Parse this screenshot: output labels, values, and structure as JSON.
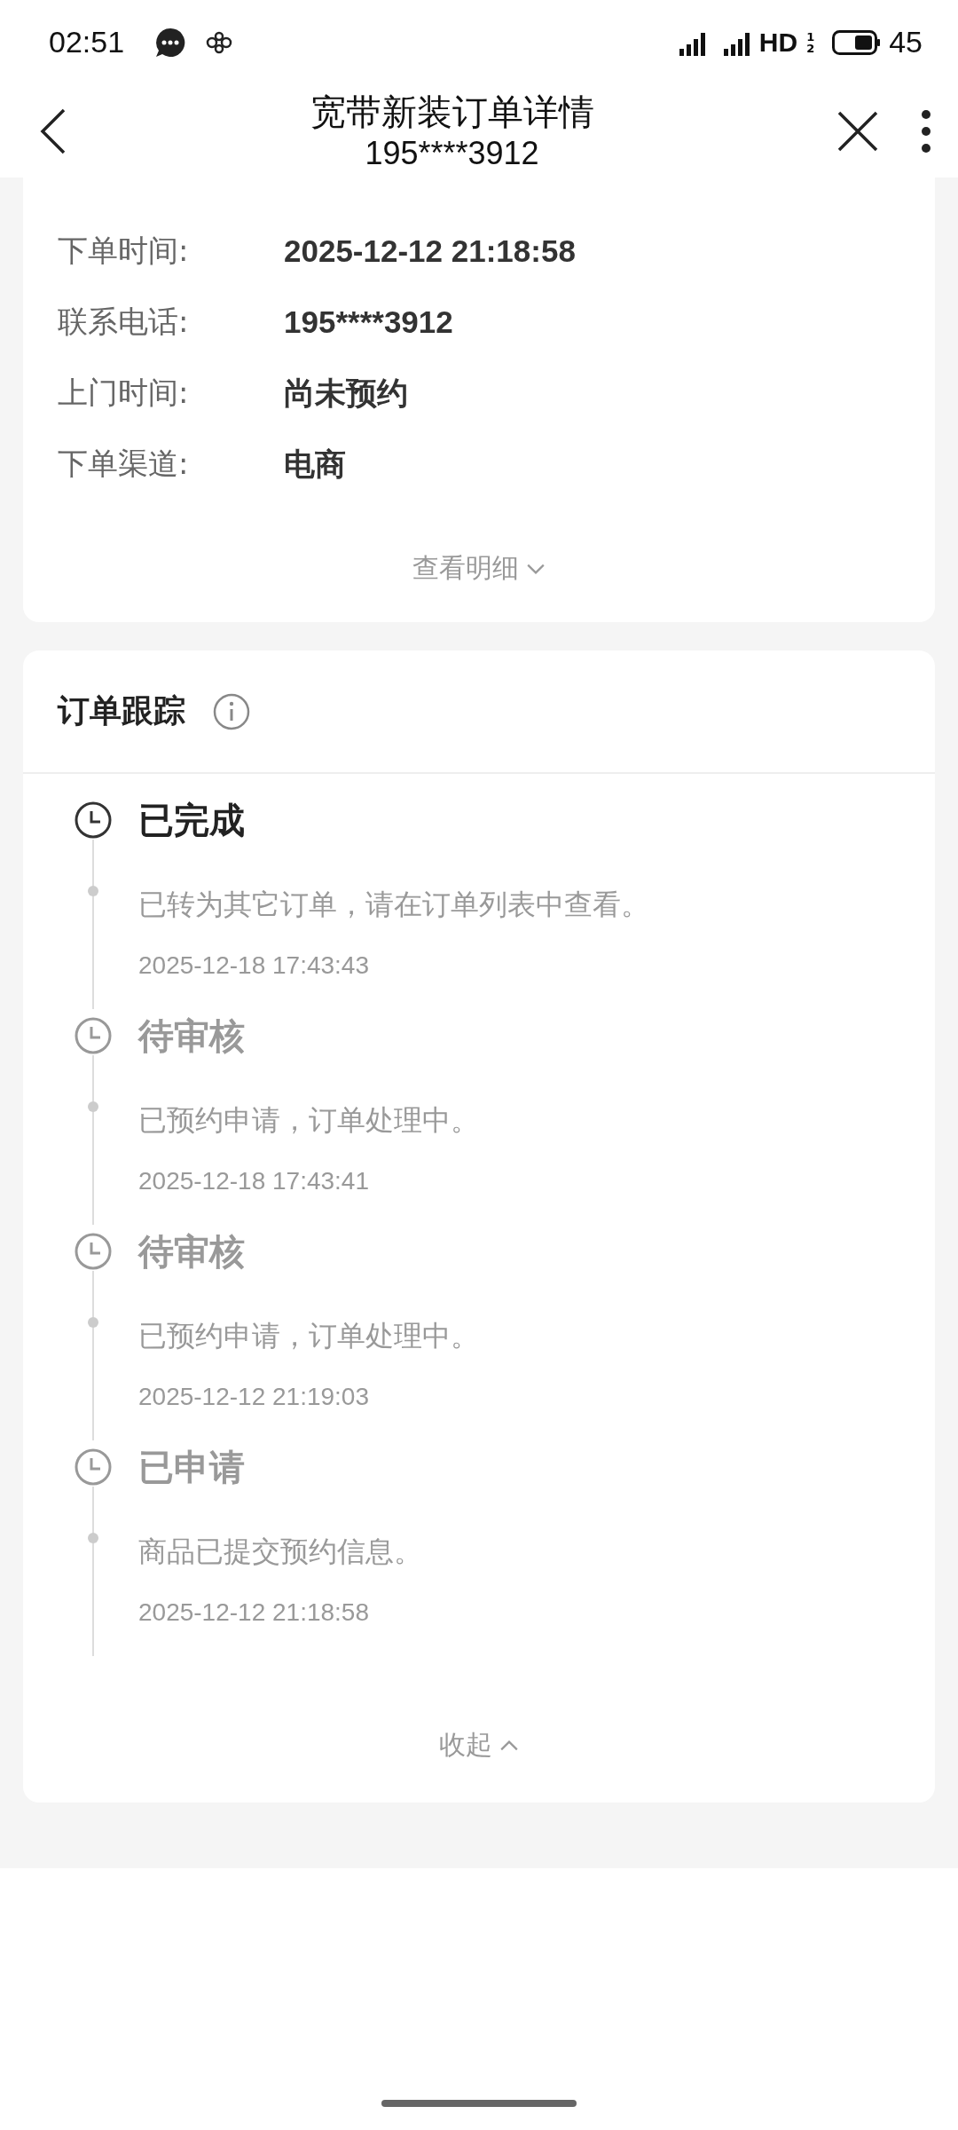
{
  "status_bar": {
    "time": "02:51",
    "hd": "HD",
    "hd_slots": [
      "1",
      "2"
    ],
    "battery": "45"
  },
  "header": {
    "title": "宽带新装订单详情",
    "subtitle": "195****3912"
  },
  "order_info": {
    "rows": [
      {
        "label": "下单时间:",
        "value": "2025-12-12 21:18:58"
      },
      {
        "label": "联系电话:",
        "value": "195****3912"
      },
      {
        "label": "上门时间:",
        "value": "尚未预约"
      },
      {
        "label": "下单渠道:",
        "value": "电商"
      }
    ],
    "toggle": "查看明细",
    "expanded": false
  },
  "tracking": {
    "title": "订单跟踪",
    "steps": [
      {
        "status": "已完成",
        "current": true,
        "note": "已转为其它订单，请在订单列表中查看。",
        "time": "2025-12-18 17:43:43"
      },
      {
        "status": "待审核",
        "current": false,
        "note": "已预约申请，订单处理中。",
        "time": "2025-12-18 17:43:41"
      },
      {
        "status": "待审核",
        "current": false,
        "note": "已预约申请，订单处理中。",
        "time": "2025-12-12 21:19:03"
      },
      {
        "status": "已申请",
        "current": false,
        "note": "商品已提交预约信息。",
        "time": "2025-12-12 21:18:58"
      }
    ],
    "toggle": "收起",
    "expanded": true
  }
}
